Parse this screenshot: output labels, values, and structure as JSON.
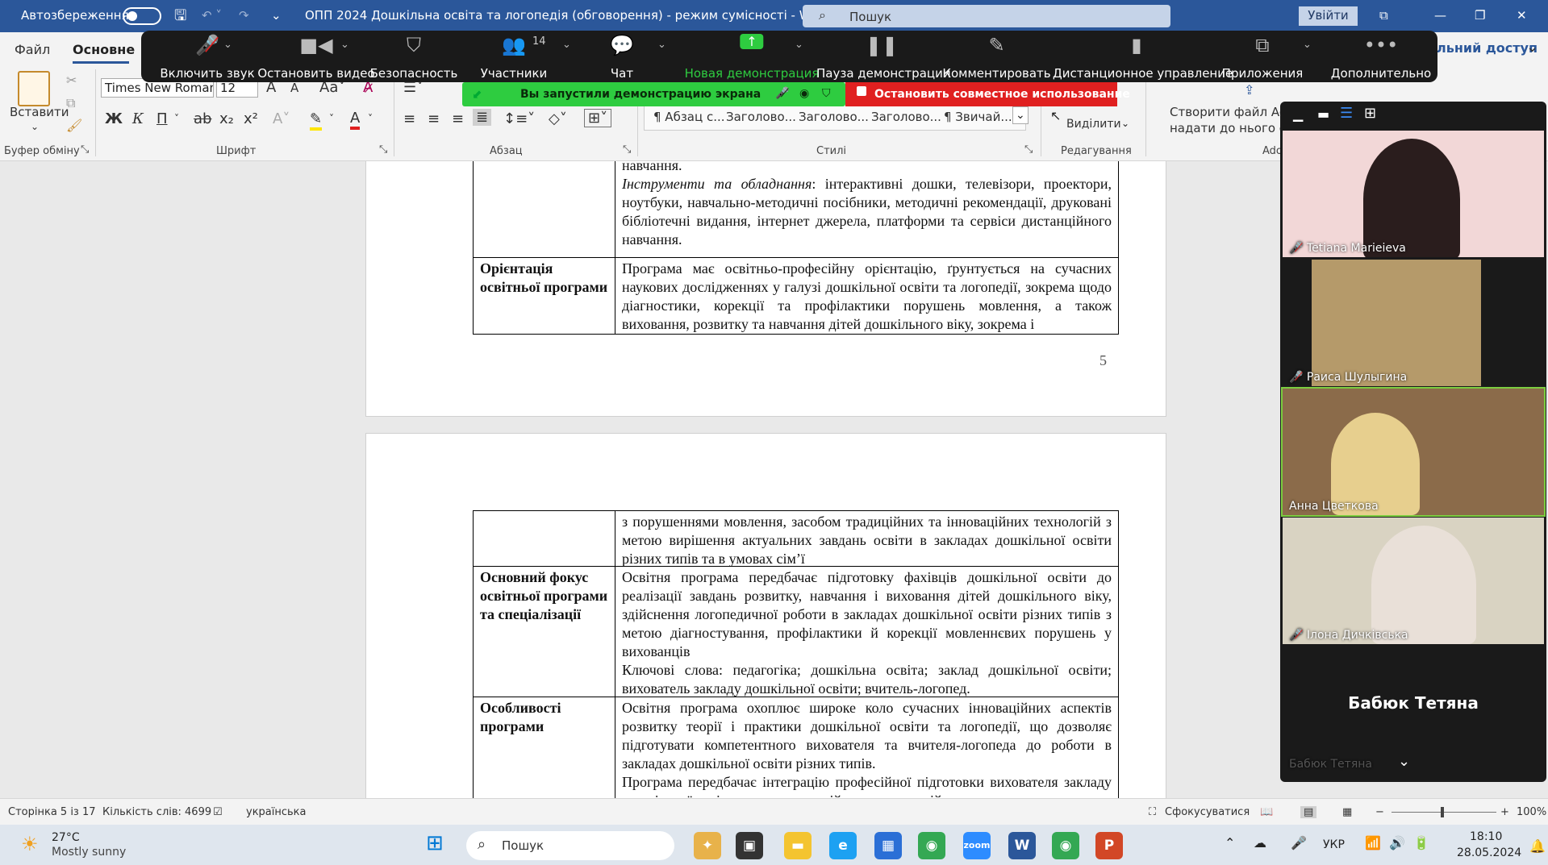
{
  "titlebar": {
    "autosave_label": "Автозбереження",
    "doc_title": "ОПП 2024 Дошкільна освіта та логопедія (обговорення)  -  режим сумісності  -  Word",
    "search_placeholder": "Пошук",
    "signin_label": "Увійти"
  },
  "ribbon_tabs": {
    "file": "Файл",
    "home": "Основне",
    "share": "льний доступ"
  },
  "clipboard": {
    "paste_label": "Вставити",
    "group_label": "Буфер обміну"
  },
  "font": {
    "name": "Times New Roman",
    "size": "12",
    "group_label": "Шрифт"
  },
  "paragraph": {
    "group_label": "Абзац"
  },
  "styles": {
    "items": [
      "¶ Абзац с...",
      "Заголово...",
      "Заголово...",
      "Заголово...",
      "¶ Звичай..."
    ],
    "group_label": "Стилі"
  },
  "editing": {
    "select_label": "Виділити",
    "group_label": "Редагування"
  },
  "adobe": {
    "line1": "Створити файл Ado",
    "line2": "надати до нього спіль",
    "group_label": "Ado"
  },
  "zoom_toolbar": {
    "buttons": [
      {
        "label": "Включить звук",
        "icon": "mic-muted-icon"
      },
      {
        "label": "Остановить видео",
        "icon": "video-camera-icon"
      },
      {
        "label": "Безопасность",
        "icon": "shield-icon"
      },
      {
        "label": "Участники",
        "icon": "participants-icon",
        "count": "14"
      },
      {
        "label": "Чат",
        "icon": "chat-icon"
      },
      {
        "label": "Новая демонстрация",
        "icon": "share-screen-icon"
      },
      {
        "label": "Пауза демонстрации",
        "icon": "pause-icon"
      },
      {
        "label": "Комментировать",
        "icon": "pen-icon"
      },
      {
        "label": "Дистанционное управление",
        "icon": "mouse-icon"
      },
      {
        "label": "Приложения",
        "icon": "apps-icon"
      },
      {
        "label": "Дополнительно",
        "icon": "more-icon"
      }
    ],
    "share_notice": "Вы запустили демонстрацию экрана",
    "stop_share": "Остановить совместное использование",
    "accent_green": "#2ecc40",
    "accent_red": "#e02020"
  },
  "document": {
    "page1": {
      "rows": [
        {
          "label": "",
          "text_lines": [
            "навчання."
          ],
          "italic_lead": "Інструменти та обладнання",
          "text": ": інтерактивні дошки, телевізори, проектори, ноутбуки, навчально-методичні посібники, методичні рекомендації, друковані бібліотечні видання,  інтернет джерела, платформи та сервіси дистанційного навчання."
        },
        {
          "label": "Орієнтація освітньої програми",
          "text": "Програма має освітньо-професійну орієнтацію, ґрунтується на сучасних наукових дослідженнях у галузі дошкільної освіти та логопедії, зокрема щодо діагностики, корекції та профілактики порушень мовлення, а також виховання, розвитку та навчання дітей дошкільного віку, зокрема і"
        }
      ],
      "page_number": "5"
    },
    "page2": {
      "rows": [
        {
          "label": "",
          "text": "з порушеннями мовлення, засобом традиційних та інноваційних технологій з метою вирішення актуальних завдань освіти в закладах дошкільної освіти різних типів та в умовах сім’ї"
        },
        {
          "label": "Основний фокус освітньої програми та спеціалізації",
          "text": "Освітня програма передбачає підготовку фахівців дошкільної освіти до реалізації завдань розвитку, навчання і виховання дітей дошкільного віку, здійснення логопедичної роботи в закладах дошкільної освіти різних типів з метою діагностування, профілактики й корекції мовленнєвих порушень у вихованців",
          "text2": "Ключові слова: педагогіка; дошкільна освіта; заклад дошкільної освіти; вихователь закладу дошкільної освіти; вчитель-логопед."
        },
        {
          "label": "Особливості програми",
          "text": "Освітня програма охоплює широке коло сучасних інноваційних аспектів розвитку теорії і практики дошкільної освіти та логопедії, що дозволяє підготувати компетентного вихователя та вчителя-логопеда до роботи в закладах дошкільної освіти різних типів.",
          "text2": "Програма передбачає інтеграцію професійної підготовки вихователя закладу дошкільної освіти, здатного до здійснення корекційно-"
        }
      ]
    }
  },
  "participants": [
    {
      "name": "Tetiana Marieieva",
      "muted": true
    },
    {
      "name": "Раиса Шулыгина",
      "muted": true
    },
    {
      "name": "Анна Цветкова",
      "muted": false
    },
    {
      "name": "Ілона Дичківська",
      "muted": true
    },
    {
      "name": "Бабюк Тетяна",
      "muted": false,
      "no_video": true
    }
  ],
  "statusbar": {
    "page": "Сторінка 5 із 17",
    "words": "Кількість слів: 4699",
    "language": "українська",
    "focus": "Сфокусуватися",
    "zoom": "100%"
  },
  "taskbar": {
    "weather_temp": "27°C",
    "weather_desc": "Mostly sunny",
    "search_label": "Пошук",
    "lang": "УКР",
    "time": "18:10",
    "date": "28.05.2024"
  }
}
